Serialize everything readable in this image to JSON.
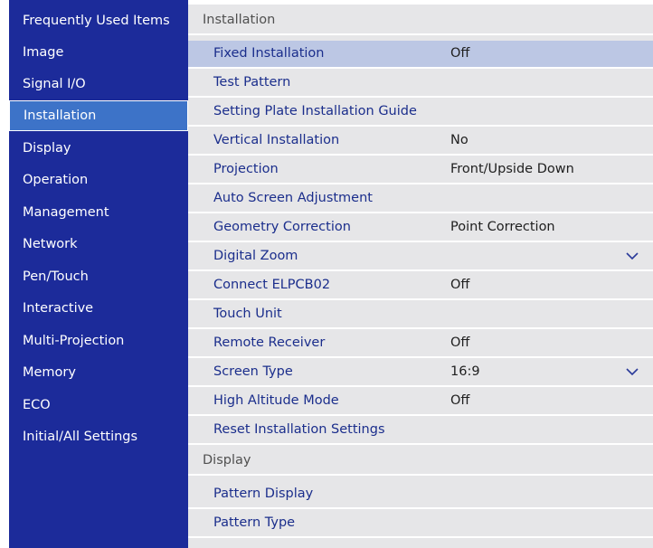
{
  "sidebar": {
    "items": [
      {
        "label": "Frequently Used Items",
        "selected": false
      },
      {
        "label": "Image",
        "selected": false
      },
      {
        "label": "Signal I/O",
        "selected": false
      },
      {
        "label": "Installation",
        "selected": true
      },
      {
        "label": "Display",
        "selected": false
      },
      {
        "label": "Operation",
        "selected": false
      },
      {
        "label": "Management",
        "selected": false
      },
      {
        "label": "Network",
        "selected": false
      },
      {
        "label": "Pen/Touch",
        "selected": false
      },
      {
        "label": "Interactive",
        "selected": false
      },
      {
        "label": "Multi-Projection",
        "selected": false
      },
      {
        "label": "Memory",
        "selected": false
      },
      {
        "label": "ECO",
        "selected": false
      },
      {
        "label": "Initial/All Settings",
        "selected": false
      }
    ]
  },
  "main": {
    "installation_header": "Installation",
    "installation_rows": [
      {
        "label": "Fixed Installation",
        "value": "Off",
        "highlight": true
      },
      {
        "label": "Test Pattern",
        "value": ""
      },
      {
        "label": "Setting Plate Installation Guide",
        "value": ""
      },
      {
        "label": "Vertical Installation",
        "value": "No"
      },
      {
        "label": "Projection",
        "value": "Front/Upside Down"
      },
      {
        "label": "Auto Screen Adjustment",
        "value": ""
      },
      {
        "label": "Geometry Correction",
        "value": "Point Correction"
      },
      {
        "label": "Digital Zoom",
        "value": "",
        "expand": true
      },
      {
        "label": "Connect ELPCB02",
        "value": "Off"
      },
      {
        "label": "Touch Unit",
        "value": ""
      },
      {
        "label": "Remote Receiver",
        "value": "Off"
      },
      {
        "label": "Screen Type",
        "value": "16:9",
        "expand": true
      },
      {
        "label": "High Altitude Mode",
        "value": "Off"
      },
      {
        "label": "Reset Installation Settings",
        "value": ""
      }
    ],
    "display_header": "Display",
    "display_rows": [
      {
        "label": "Pattern Display",
        "value": ""
      },
      {
        "label": "Pattern Type",
        "value": ""
      }
    ]
  },
  "colors": {
    "sidebar_bg": "#1c2b9a",
    "sidebar_selected": "#3d73c8",
    "row_bg": "#e6e6e8",
    "row_highlight": "#bcc7e4",
    "label_text": "#1b2e8c"
  },
  "icons": {
    "expand": "chevron-down-icon"
  }
}
